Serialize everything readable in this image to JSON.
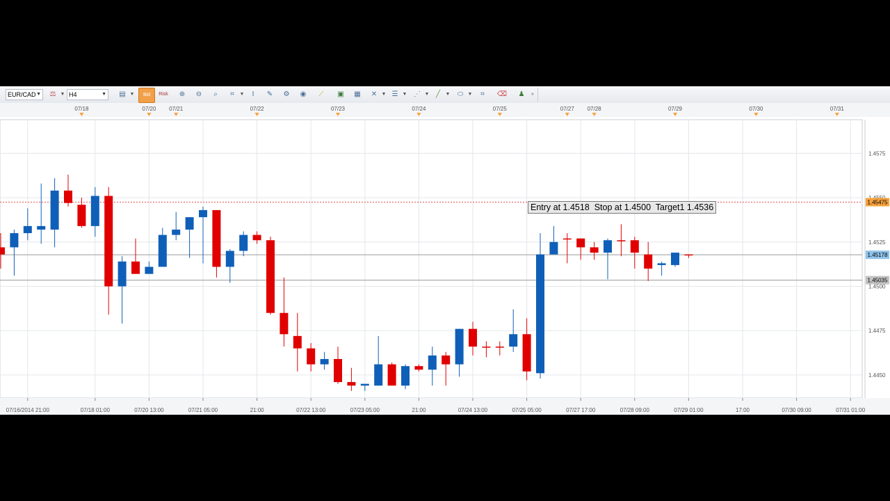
{
  "toolbar": {
    "symbol": "EUR/CAD",
    "timeframe": "H4",
    "bid_label": "Bid",
    "risk_label": "Risk"
  },
  "colors": {
    "bull": "#0f5fb8",
    "bear": "#e00000",
    "grid": "#e3e6ea",
    "axis_text": "#555555",
    "highlight_orange": "#f7a23c",
    "highlight_blue": "#8fc3ea",
    "highlight_gray": "#c3c3c3"
  },
  "annotation": {
    "text": "Entry at 1.4518  Stop at 1.4500  Target1 1.4536"
  },
  "chart_data": {
    "type": "candlestick",
    "symbol": "EUR/CAD",
    "timeframe": "H4",
    "ylim": [
      1.4437,
      1.4594
    ],
    "grid": true,
    "y_ticks": [
      "1.4575",
      "1.4550",
      "1.4525",
      "1.4500",
      "1.4475",
      "1.4450"
    ],
    "top_date_labels": [
      {
        "index": 6,
        "label": "07/18"
      },
      {
        "index": 11,
        "label": "07/20"
      },
      {
        "index": 13,
        "label": "07/21"
      },
      {
        "index": 19,
        "label": "07/22"
      },
      {
        "index": 25,
        "label": "07/23"
      },
      {
        "index": 31,
        "label": "07/24"
      },
      {
        "index": 37,
        "label": "07/25"
      },
      {
        "index": 42,
        "label": "07/27"
      },
      {
        "index": 44,
        "label": "07/28"
      },
      {
        "index": 50,
        "label": "07/29"
      },
      {
        "index": 56,
        "label": "07/30"
      },
      {
        "index": 62,
        "label": "07/31"
      }
    ],
    "bottom_time_labels": [
      {
        "index": 2,
        "label": "07/16/2014 21:00"
      },
      {
        "index": 7,
        "label": "07/18 01:00"
      },
      {
        "index": 11,
        "label": "07/20 13:00"
      },
      {
        "index": 15,
        "label": "07/21 05:00"
      },
      {
        "index": 19,
        "label": "21:00"
      },
      {
        "index": 23,
        "label": "07/22 13:00"
      },
      {
        "index": 27,
        "label": "07/23 05:00"
      },
      {
        "index": 31,
        "label": "21:00"
      },
      {
        "index": 35,
        "label": "07/24 13:00"
      },
      {
        "index": 39,
        "label": "07/25 05:00"
      },
      {
        "index": 43,
        "label": "07/27 17:00"
      },
      {
        "index": 47,
        "label": "07/28 09:00"
      },
      {
        "index": 51,
        "label": "07/29 01:00"
      },
      {
        "index": 55,
        "label": "17:00"
      },
      {
        "index": 59,
        "label": "07/30 09:00"
      },
      {
        "index": 63,
        "label": "07/31 01:00"
      }
    ],
    "candles": [
      {
        "o": 1.4522,
        "h": 1.453,
        "l": 1.451,
        "c": 1.4518
      },
      {
        "o": 1.4522,
        "h": 1.4532,
        "l": 1.4506,
        "c": 1.453
      },
      {
        "o": 1.453,
        "h": 1.4544,
        "l": 1.4526,
        "c": 1.4534
      },
      {
        "o": 1.4532,
        "h": 1.4558,
        "l": 1.4524,
        "c": 1.4534
      },
      {
        "o": 1.4532,
        "h": 1.4561,
        "l": 1.4522,
        "c": 1.4554
      },
      {
        "o": 1.4554,
        "h": 1.4563,
        "l": 1.4545,
        "c": 1.4547
      },
      {
        "o": 1.4546,
        "h": 1.455,
        "l": 1.4533,
        "c": 1.4534
      },
      {
        "o": 1.4534,
        "h": 1.4556,
        "l": 1.4528,
        "c": 1.4551
      },
      {
        "o": 1.4551,
        "h": 1.4556,
        "l": 1.4484,
        "c": 1.45
      },
      {
        "o": 1.45,
        "h": 1.4517,
        "l": 1.4479,
        "c": 1.4514
      },
      {
        "o": 1.4514,
        "h": 1.4527,
        "l": 1.4507,
        "c": 1.4507
      },
      {
        "o": 1.4507,
        "h": 1.4514,
        "l": 1.4507,
        "c": 1.4511
      },
      {
        "o": 1.4511,
        "h": 1.4533,
        "l": 1.4511,
        "c": 1.4529
      },
      {
        "o": 1.4529,
        "h": 1.4542,
        "l": 1.4526,
        "c": 1.4532
      },
      {
        "o": 1.4532,
        "h": 1.4539,
        "l": 1.4516,
        "c": 1.4539
      },
      {
        "o": 1.4539,
        "h": 1.4545,
        "l": 1.4513,
        "c": 1.4543
      },
      {
        "o": 1.4543,
        "h": 1.4543,
        "l": 1.4505,
        "c": 1.4511
      },
      {
        "o": 1.4511,
        "h": 1.4521,
        "l": 1.4502,
        "c": 1.452
      },
      {
        "o": 1.452,
        "h": 1.4531,
        "l": 1.4517,
        "c": 1.4529
      },
      {
        "o": 1.4529,
        "h": 1.4531,
        "l": 1.4524,
        "c": 1.4526
      },
      {
        "o": 1.4526,
        "h": 1.4528,
        "l": 1.4484,
        "c": 1.4485
      },
      {
        "o": 1.4485,
        "h": 1.4505,
        "l": 1.4466,
        "c": 1.4473
      },
      {
        "o": 1.4472,
        "h": 1.4485,
        "l": 1.4452,
        "c": 1.4465
      },
      {
        "o": 1.4465,
        "h": 1.4468,
        "l": 1.4452,
        "c": 1.4456
      },
      {
        "o": 1.4456,
        "h": 1.4463,
        "l": 1.4453,
        "c": 1.4459
      },
      {
        "o": 1.4459,
        "h": 1.4466,
        "l": 1.4445,
        "c": 1.4446
      },
      {
        "o": 1.4446,
        "h": 1.4454,
        "l": 1.4441,
        "c": 1.4444
      },
      {
        "o": 1.4444,
        "h": 1.4445,
        "l": 1.4441,
        "c": 1.4445
      },
      {
        "o": 1.4444,
        "h": 1.4472,
        "l": 1.4444,
        "c": 1.4456
      },
      {
        "o": 1.4456,
        "h": 1.4457,
        "l": 1.4444,
        "c": 1.4444
      },
      {
        "o": 1.4444,
        "h": 1.4456,
        "l": 1.4442,
        "c": 1.4455
      },
      {
        "o": 1.4455,
        "h": 1.4456,
        "l": 1.4452,
        "c": 1.4453
      },
      {
        "o": 1.4453,
        "h": 1.4466,
        "l": 1.4444,
        "c": 1.4461
      },
      {
        "o": 1.4461,
        "h": 1.4463,
        "l": 1.4444,
        "c": 1.4456
      },
      {
        "o": 1.4456,
        "h": 1.4476,
        "l": 1.4449,
        "c": 1.4476
      },
      {
        "o": 1.4476,
        "h": 1.448,
        "l": 1.4461,
        "c": 1.4466
      },
      {
        "o": 1.4466,
        "h": 1.4469,
        "l": 1.446,
        "c": 1.4466
      },
      {
        "o": 1.4466,
        "h": 1.4469,
        "l": 1.4461,
        "c": 1.4466
      },
      {
        "o": 1.4466,
        "h": 1.4487,
        "l": 1.4463,
        "c": 1.4473
      },
      {
        "o": 1.4473,
        "h": 1.4482,
        "l": 1.4447,
        "c": 1.4452
      },
      {
        "o": 1.4451,
        "h": 1.453,
        "l": 1.4448,
        "c": 1.4518
      },
      {
        "o": 1.4518,
        "h": 1.4534,
        "l": 1.4518,
        "c": 1.4525
      },
      {
        "o": 1.4527,
        "h": 1.453,
        "l": 1.4513,
        "c": 1.4527
      },
      {
        "o": 1.4527,
        "h": 1.4527,
        "l": 1.4515,
        "c": 1.4522
      },
      {
        "o": 1.4522,
        "h": 1.4525,
        "l": 1.4515,
        "c": 1.4519
      },
      {
        "o": 1.4519,
        "h": 1.4527,
        "l": 1.4504,
        "c": 1.4526
      },
      {
        "o": 1.4526,
        "h": 1.4535,
        "l": 1.4517,
        "c": 1.4526
      },
      {
        "o": 1.4526,
        "h": 1.4528,
        "l": 1.451,
        "c": 1.4519
      },
      {
        "o": 1.4518,
        "h": 1.4525,
        "l": 1.4503,
        "c": 1.451
      },
      {
        "o": 1.4512,
        "h": 1.4514,
        "l": 1.4506,
        "c": 1.4513
      },
      {
        "o": 1.4512,
        "h": 1.4519,
        "l": 1.4511,
        "c": 1.4519
      },
      {
        "o": 1.4518,
        "h": 1.4518,
        "l": 1.4516,
        "c": 1.4518
      }
    ],
    "price_lines": [
      {
        "label": "1.45475",
        "value": 1.45475,
        "style": "dotted-red",
        "marker": "orange"
      },
      {
        "label": "1.45178",
        "value": 1.45178,
        "style": "solid-gray",
        "marker": "blue"
      },
      {
        "label": "1.45035",
        "value": 1.45035,
        "style": "solid-gray",
        "marker": "gray"
      }
    ]
  }
}
